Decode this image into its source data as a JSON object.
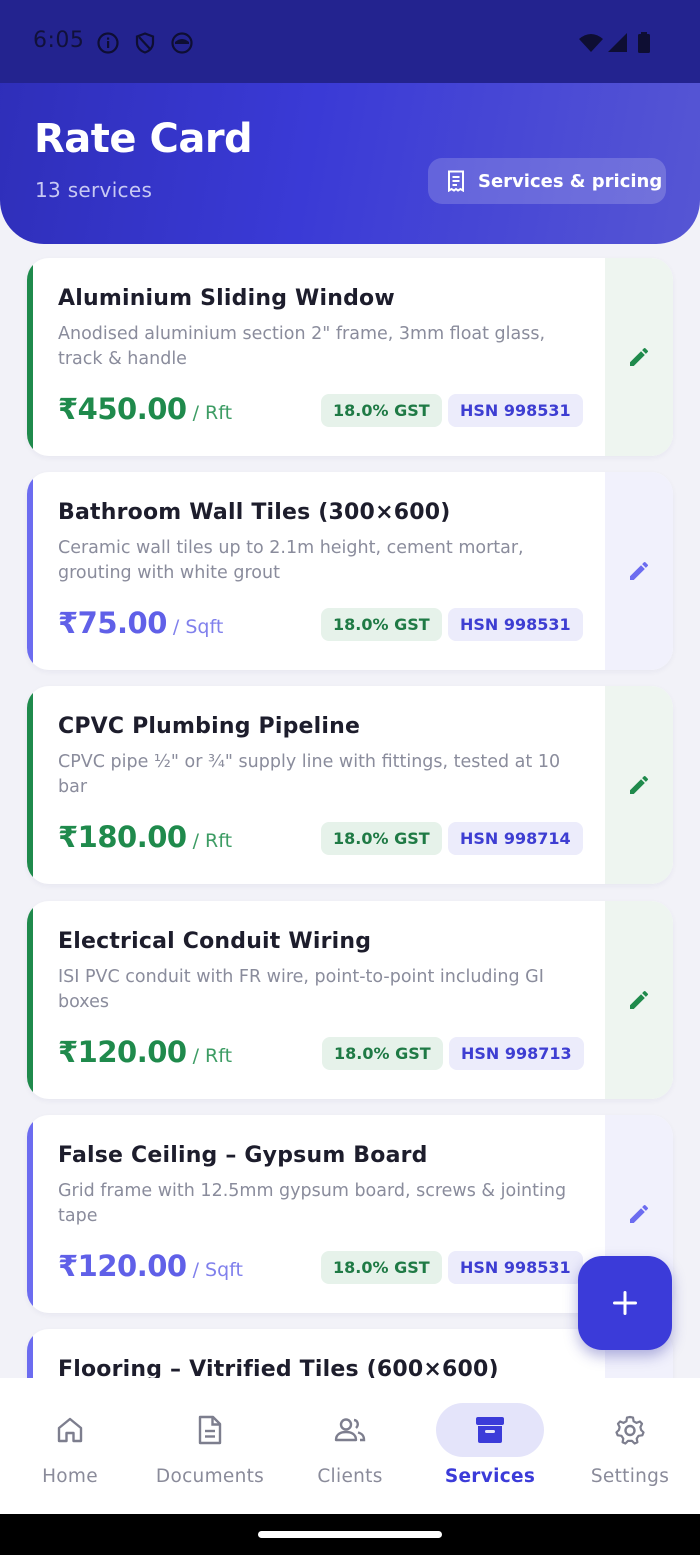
{
  "status": {
    "time": "6:05"
  },
  "header": {
    "title": "Rate Card",
    "subtitle": "13 services",
    "pill_label": "Services & pricing"
  },
  "services": [
    {
      "title": "Aluminium Sliding Window",
      "description": "Anodised aluminium section 2\" frame, 3mm float glass, track & handle",
      "price": "₹450.00",
      "unit": "/ Rft",
      "gst": "18.0% GST",
      "hsn": "HSN 998531",
      "accent": "green"
    },
    {
      "title": "Bathroom Wall Tiles (300×600)",
      "description": "Ceramic wall tiles up to 2.1m height, cement mortar, grouting with white grout",
      "price": "₹75.00",
      "unit": "/ Sqft",
      "gst": "18.0% GST",
      "hsn": "HSN 998531",
      "accent": "blue"
    },
    {
      "title": "CPVC Plumbing Pipeline",
      "description": "CPVC pipe ½\" or ¾\" supply line with fittings, tested at 10 bar",
      "price": "₹180.00",
      "unit": "/ Rft",
      "gst": "18.0% GST",
      "hsn": "HSN 998714",
      "accent": "green"
    },
    {
      "title": "Electrical Conduit Wiring",
      "description": "ISI PVC conduit with FR wire, point-to-point including GI boxes",
      "price": "₹120.00",
      "unit": "/ Rft",
      "gst": "18.0% GST",
      "hsn": "HSN 998713",
      "accent": "green"
    },
    {
      "title": "False Ceiling – Gypsum Board",
      "description": "Grid frame with 12.5mm gypsum board, screws & jointing tape",
      "price": "₹120.00",
      "unit": "/ Sqft",
      "gst": "18.0% GST",
      "hsn": "HSN 998531",
      "accent": "blue"
    },
    {
      "title": "Flooring – Vitrified Tiles (600×600)",
      "accent": "blue"
    }
  ],
  "nav": {
    "items": [
      {
        "label": "Home",
        "icon": "home-icon"
      },
      {
        "label": "Documents",
        "icon": "document-icon"
      },
      {
        "label": "Clients",
        "icon": "clients-icon"
      },
      {
        "label": "Services",
        "icon": "services-icon",
        "active": true
      },
      {
        "label": "Settings",
        "icon": "settings-icon"
      }
    ]
  },
  "colors": {
    "primary": "#3b3bd9",
    "green": "#1f8a4c",
    "blue_accent": "#6c6cf0"
  }
}
